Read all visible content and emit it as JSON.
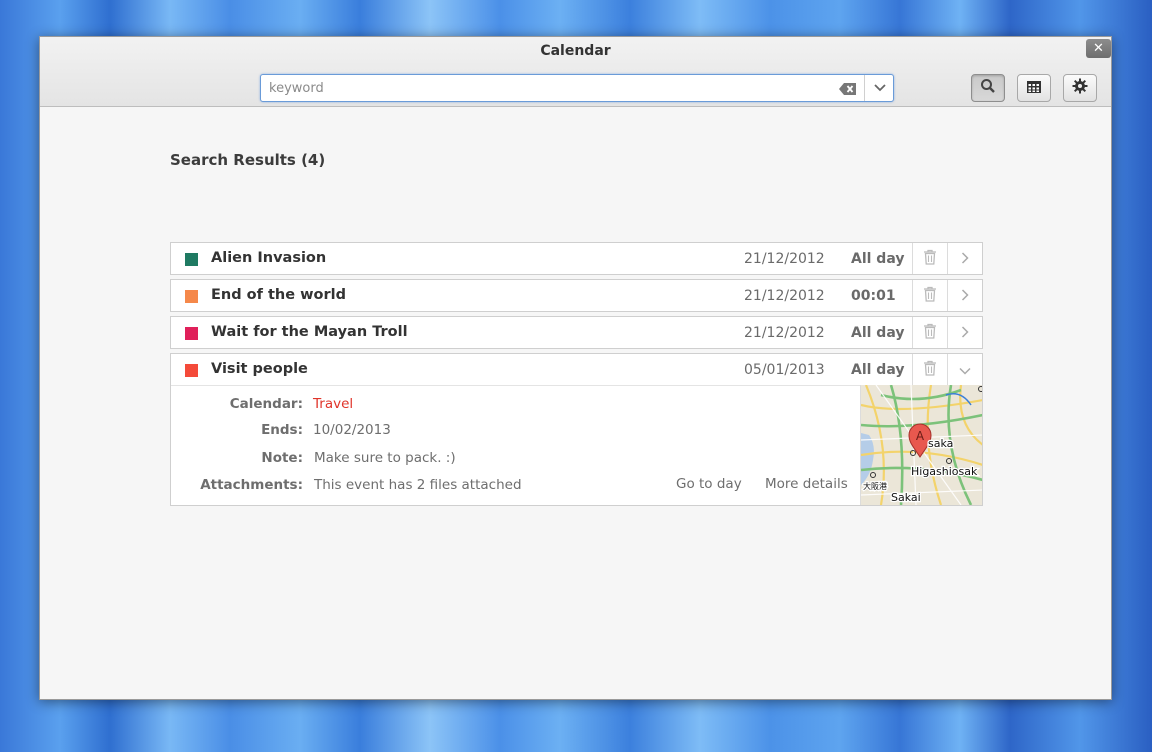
{
  "window": {
    "title": "Calendar",
    "close_label": "✕"
  },
  "search": {
    "placeholder": "keyword",
    "value": ""
  },
  "toolbar": {
    "buttons": [
      "search",
      "calendar-grid",
      "settings"
    ],
    "active": "search"
  },
  "results": {
    "heading": "Search Results (4)",
    "items": [
      {
        "title": "Alien Invasion",
        "date": "21/12/2012",
        "time": "All day",
        "color": "#1f7a62"
      },
      {
        "title": "End of the world",
        "date": "21/12/2012",
        "time": "00:01",
        "color": "#f5884a"
      },
      {
        "title": "Wait for the Mayan Troll",
        "date": "21/12/2012",
        "time": "All day",
        "color": "#e0205a"
      },
      {
        "title": "Visit people",
        "date": "05/01/2013",
        "time": "All day",
        "color": "#f44a3a"
      }
    ]
  },
  "details": {
    "calendar_label": "Calendar:",
    "calendar_value": "Travel",
    "calendar_color": "#e0342a",
    "ends_label": "Ends:",
    "ends_value": "10/02/2013",
    "note_label": "Note:",
    "note_value": "Make sure to pack. :)",
    "attachments_label": "Attachments:",
    "attachments_value": "This event has 2 files attached",
    "go_to_day": "Go to day",
    "more_details": "More details"
  },
  "map": {
    "marker": "A",
    "labels": [
      "saka",
      "Higashiosak",
      "Sakai",
      "大阪港"
    ]
  }
}
